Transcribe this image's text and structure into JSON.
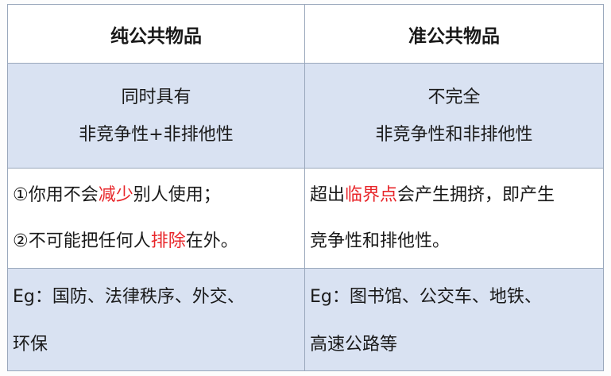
{
  "headers": {
    "pure": "纯公共物品",
    "quasi": "准公共物品"
  },
  "row_definition": {
    "pure_line1": "同时具有",
    "pure_line2": "非竞争性+非排他性",
    "quasi_line1": "不完全",
    "quasi_line2": "非竞争性和非排他性"
  },
  "row_explanation": {
    "pure_1_pre": "①你用不会",
    "pure_1_hl": "减少",
    "pure_1_post": "别人使用；",
    "pure_2_pre": "②不可能把任何人",
    "pure_2_hl": "排除",
    "pure_2_post": "在外。",
    "quasi_1_pre": "超出",
    "quasi_1_hl": "临界点",
    "quasi_1_post": "会产生拥挤，即产生",
    "quasi_2": "竞争性和排他性。"
  },
  "row_examples": {
    "pure_line1": "Eg：国防、法律秩序、外交、",
    "pure_line2": "环保",
    "quasi_line1": "Eg：图书馆、公交车、地铁、",
    "quasi_line2": "高速公路等"
  },
  "colors": {
    "highlight": "#e8262a",
    "band": "#d9e2f2",
    "border": "#9aa8bc"
  }
}
